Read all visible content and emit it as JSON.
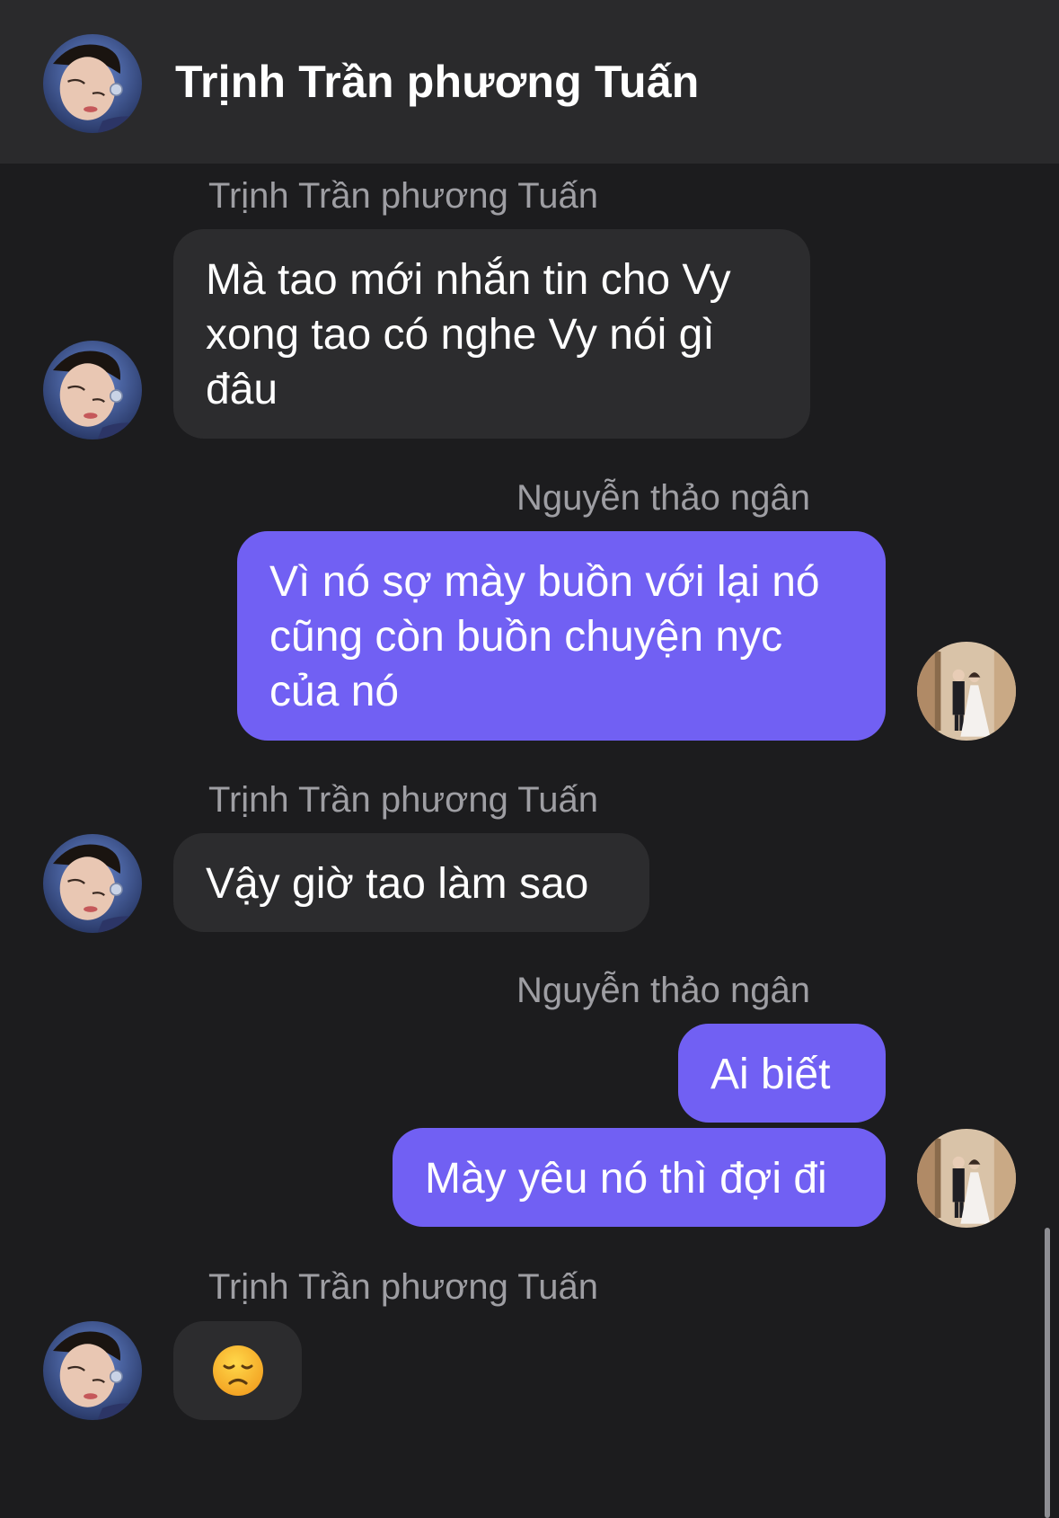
{
  "header": {
    "title": "Trịnh Trần phương Tuấn"
  },
  "messages": [
    {
      "sender": "Trịnh Trần phương Tuấn",
      "text": "Mà tao mới nhắn tin cho Vy xong tao có nghe Vy nói gì đâu"
    },
    {
      "sender": "Nguyễn thảo ngân",
      "text": "Vì nó sợ mày buồn với lại nó cũng còn buồn chuyện nyc của nó"
    },
    {
      "sender": "Trịnh Trần phương Tuấn",
      "text": "Vậy giờ tao làm sao"
    },
    {
      "sender": "Nguyễn thảo ngân",
      "text": "Ai biết"
    },
    {
      "text": "Mày yêu nó thì đợi đi"
    },
    {
      "sender": "Trịnh Trần phương Tuấn",
      "text": "😞"
    }
  ],
  "colors": {
    "background": "#1c1c1e",
    "header": "#2a2a2c",
    "incoming_bubble": "#2c2c2e",
    "outgoing_bubble": "#7160f3",
    "sender_name": "#9e9ea3"
  },
  "icons": {
    "contact_avatar": "contact-avatar-icon",
    "user_avatar": "user-avatar-icon"
  }
}
